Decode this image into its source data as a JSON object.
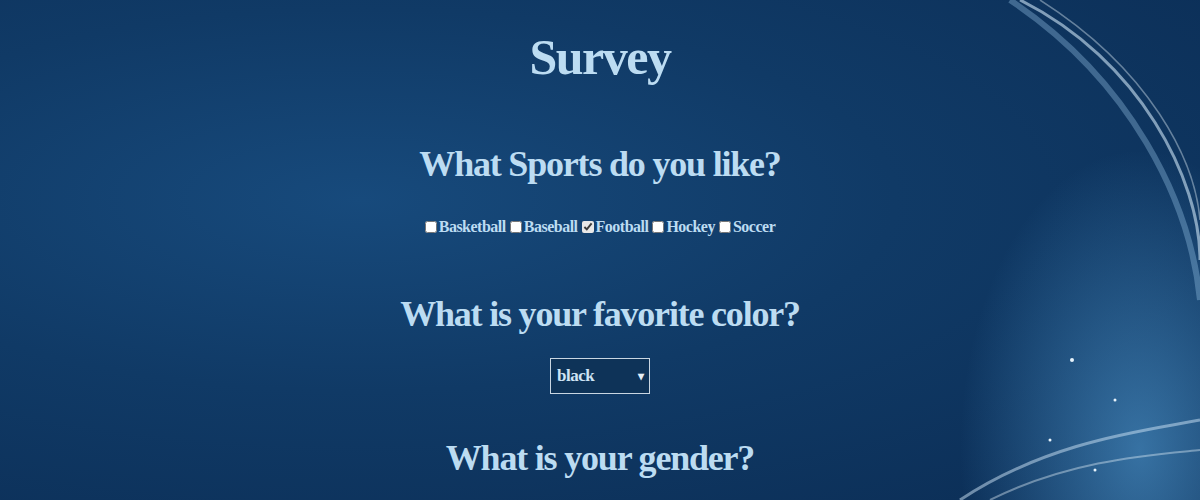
{
  "title": "Survey",
  "questions": [
    {
      "kind": "checkboxes",
      "prompt": "What Sports do you like?",
      "options": [
        {
          "label": "Basketball",
          "checked": false
        },
        {
          "label": "Baseball",
          "checked": false
        },
        {
          "label": "Football",
          "checked": true
        },
        {
          "label": "Hockey",
          "checked": false
        },
        {
          "label": "Soccer",
          "checked": false
        }
      ]
    },
    {
      "kind": "dropdown",
      "prompt": "What is your favorite color?",
      "value": "black",
      "arrow": "▾"
    },
    {
      "kind": "cut-off",
      "prompt": "What is your gender?"
    }
  ]
}
